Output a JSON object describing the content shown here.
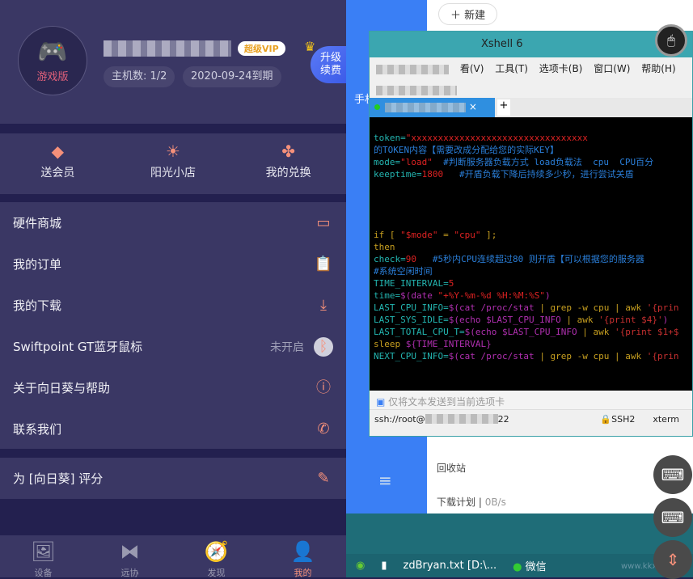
{
  "app": {
    "avatar_label": "游戏版",
    "vip_badge": "超级VIP",
    "hosts": "主机数: 1/2",
    "expiry": "2020-09-24到期",
    "upgrade": "升级续费"
  },
  "quick": [
    {
      "label": "送会员",
      "icon": "diamond-icon"
    },
    {
      "label": "阳光小店",
      "icon": "sun-icon"
    },
    {
      "label": "我的兑换",
      "icon": "pinwheel-icon"
    }
  ],
  "menu": [
    {
      "label": "硬件商城",
      "icon": "store-icon"
    },
    {
      "label": "我的订单",
      "icon": "clipboard-icon"
    },
    {
      "label": "我的下载",
      "icon": "download-icon"
    },
    {
      "label": "Swiftpoint GT蓝牙鼠标",
      "status": "未开启",
      "icon": "bluetooth-icon"
    },
    {
      "label": "关于向日葵与帮助",
      "icon": "info-icon"
    },
    {
      "label": "联系我们",
      "icon": "phone-icon"
    }
  ],
  "rate": {
    "label": "为 [向日葵] 评分",
    "icon": "edit-icon"
  },
  "nav": [
    {
      "label": "设备"
    },
    {
      "label": "远协"
    },
    {
      "label": "发现"
    },
    {
      "label": "我的",
      "active": true
    }
  ],
  "desktop": {
    "new_button": "新建",
    "side_left": "手机",
    "recycle": "回收站",
    "plan": "下载计划",
    "speed": "0B/s",
    "taskbar": [
      "zdBryan.txt [D:\\...",
      "微信"
    ],
    "watermark": "www.kkx.net"
  },
  "xshell": {
    "title": "Xshell 6",
    "menu": [
      "看(V)",
      "工具(T)",
      "选项卡(B)",
      "窗口(W)",
      "帮助(H)"
    ],
    "send_bar": "仅将文本发送到当前选项卡",
    "conn_prefix": "ssh://root@",
    "conn_suffix": "22",
    "proto": "SSH2",
    "term": "xterm"
  },
  "colors": {
    "panel": "#3a3764",
    "accent": "#f5907a",
    "blue": "#3a7ff5"
  }
}
